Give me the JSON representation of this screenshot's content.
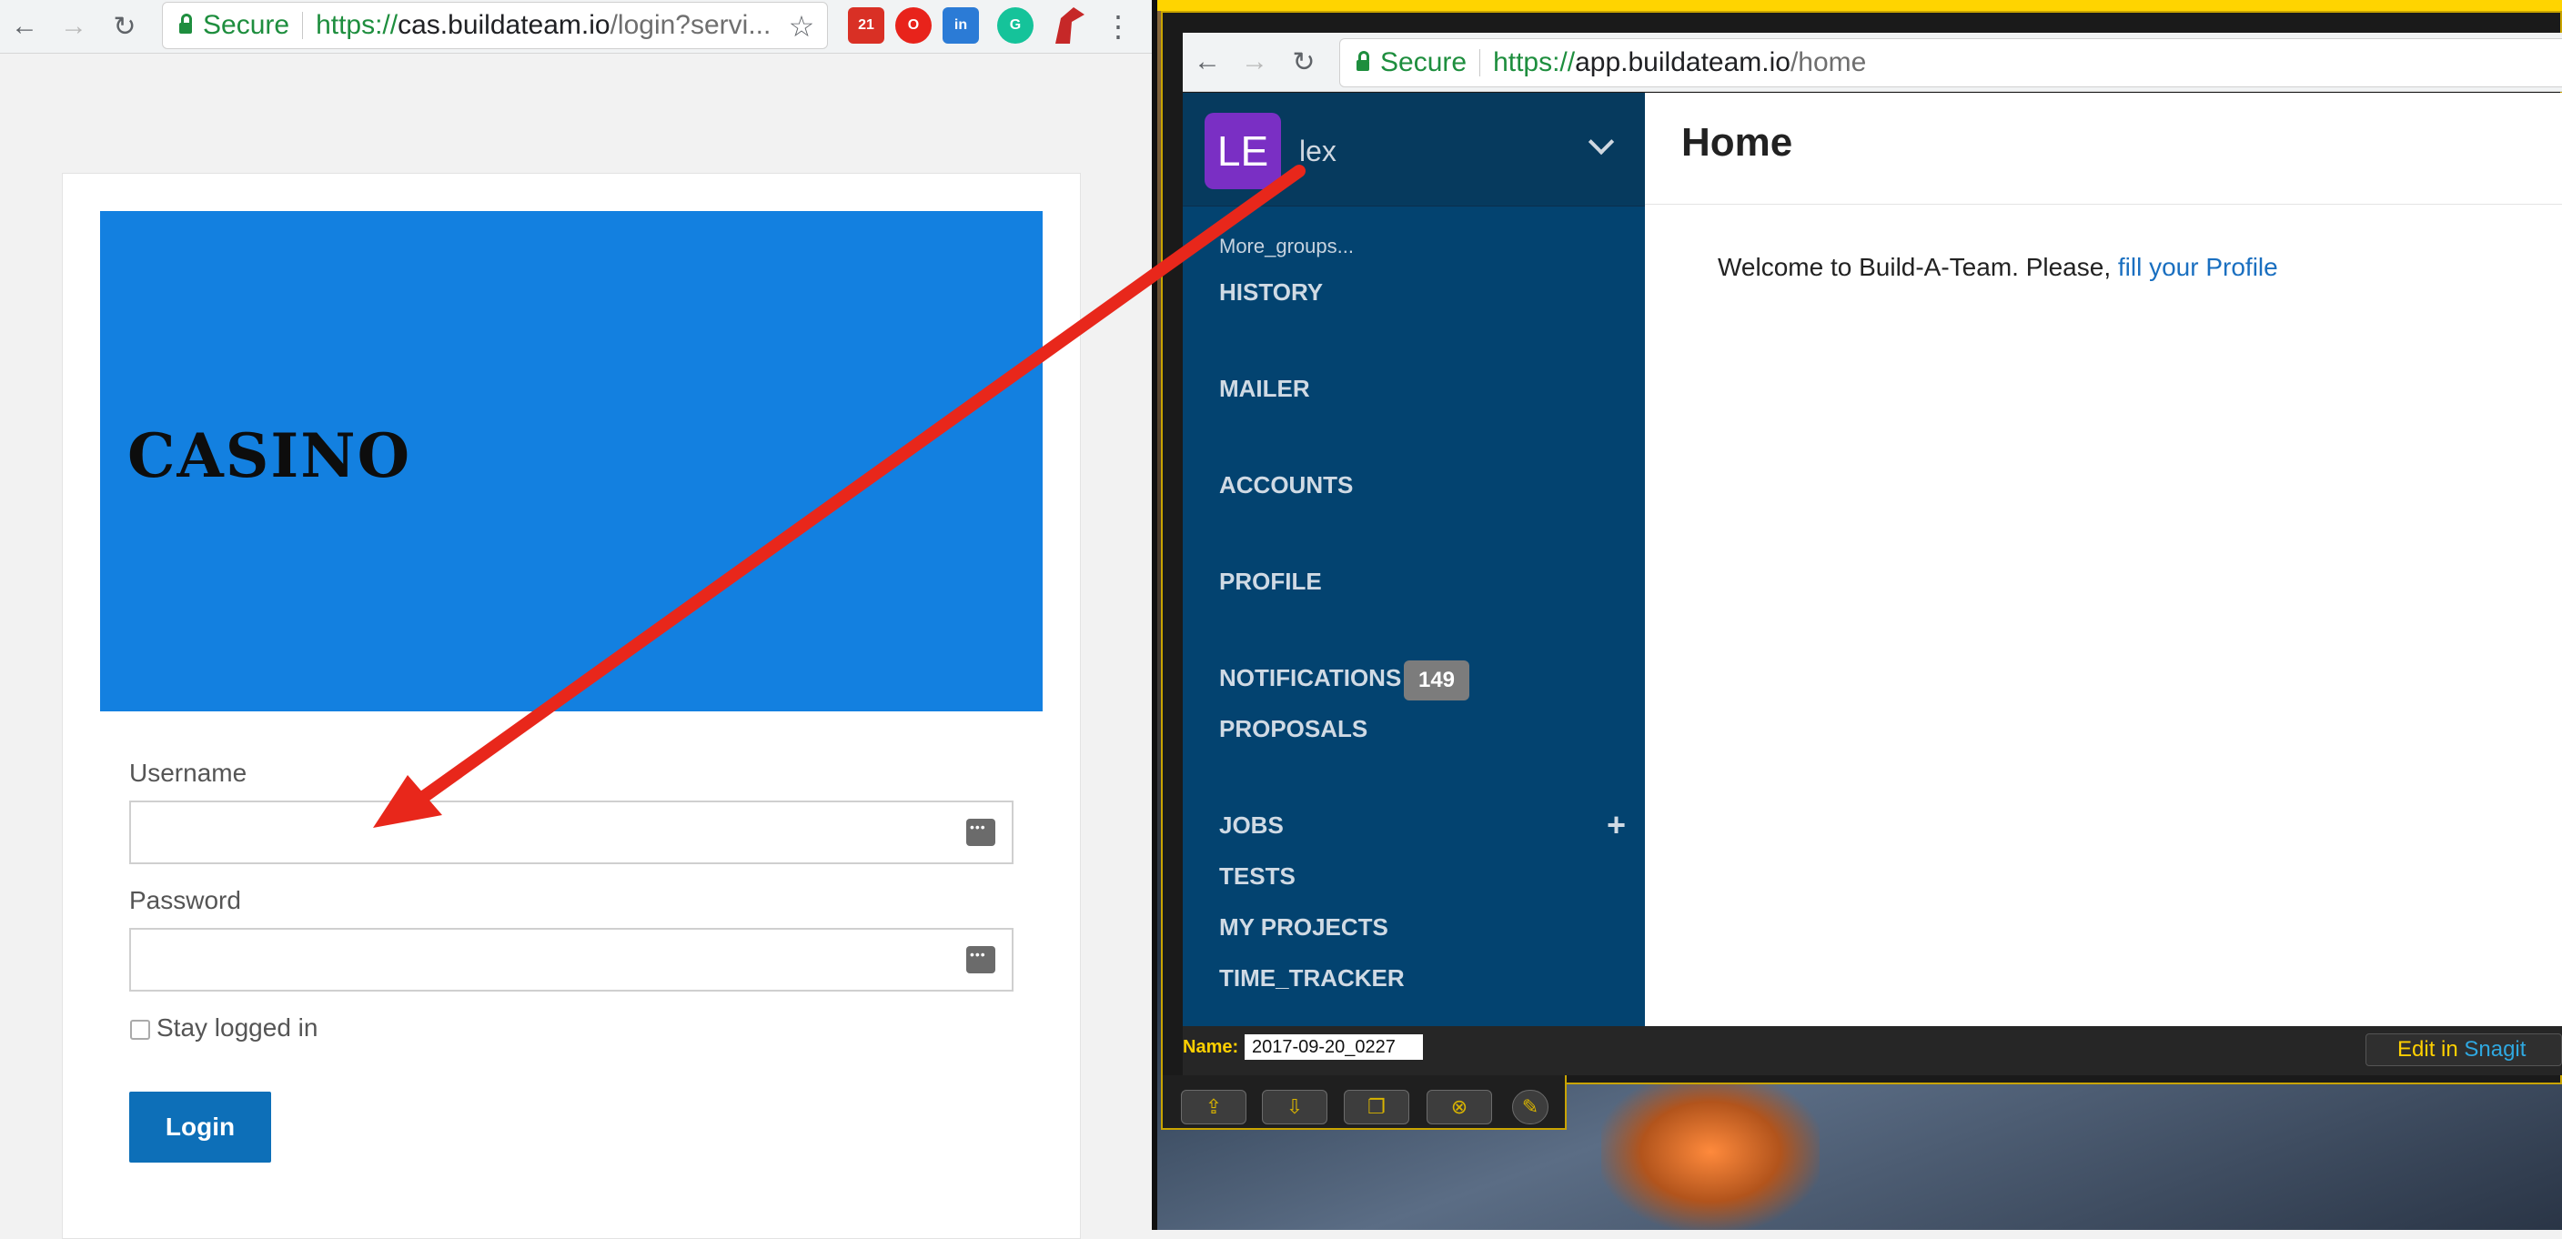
{
  "left_browser": {
    "nav": {
      "back": "←",
      "forward": "→",
      "reload": "↻"
    },
    "omnibox": {
      "secure_label": "Secure",
      "url_scheme": "https://",
      "url_host": "cas.buildateam.io",
      "url_path": "/login?servi..."
    },
    "bookmark_star": "☆",
    "extensions": [
      {
        "icon": "calendar-icon",
        "label": "21",
        "color": "#d93025"
      },
      {
        "icon": "opera-icon",
        "label": "O",
        "color": "#e8231b"
      },
      {
        "icon": "inbox-icon",
        "label": "in",
        "color": "#2b7bd6"
      },
      {
        "icon": "grammarly-icon",
        "label": "G",
        "color": "#15c39a"
      },
      {
        "icon": "dragon-icon",
        "label": "",
        "color": "#c62828"
      }
    ],
    "menu": "⋮"
  },
  "login": {
    "logo_text": "CASINO",
    "banner_color": "#1380e0",
    "username_label": "Username",
    "password_label": "Password",
    "stay_logged_in": "Stay logged in",
    "login_button": "Login",
    "button_color": "#0d6fb8"
  },
  "right_browser": {
    "nav": {
      "back": "←",
      "forward": "→",
      "reload": "↻"
    },
    "omnibox": {
      "secure_label": "Secure",
      "url_scheme": "https://",
      "url_host": "app.buildateam.io",
      "url_path": "/home"
    }
  },
  "app": {
    "avatar_initials": "LE",
    "avatar_color": "#7a2fc4",
    "user_name": "lex",
    "more_groups": "More_groups...",
    "menu": {
      "history": "HISTORY",
      "mailer": "MAILER",
      "accounts": "ACCOUNTS",
      "profile": "PROFILE",
      "notifications": "NOTIFICATIONS",
      "notifications_count": "149",
      "proposals": "PROPOSALS",
      "jobs": "JOBS",
      "jobs_add": "+",
      "tests": "TESTS",
      "my_projects": "MY PROJECTS",
      "time_tracker": "TIME_TRACKER"
    },
    "sidebar_color": "#034370",
    "page_title": "Home",
    "welcome_text": "Welcome to Build-A-Team. Please, ",
    "welcome_link": "fill your Profile"
  },
  "snagit": {
    "name_label": "Name:",
    "name_value": "2017-09-20_0227",
    "edit_prefix": "Edit in ",
    "edit_brand": "Snagit",
    "tools": [
      "share-icon",
      "save-icon",
      "copy-icon",
      "discard-icon",
      "settings-icon"
    ]
  },
  "annotation": {
    "arrow_color": "#e8271b"
  }
}
